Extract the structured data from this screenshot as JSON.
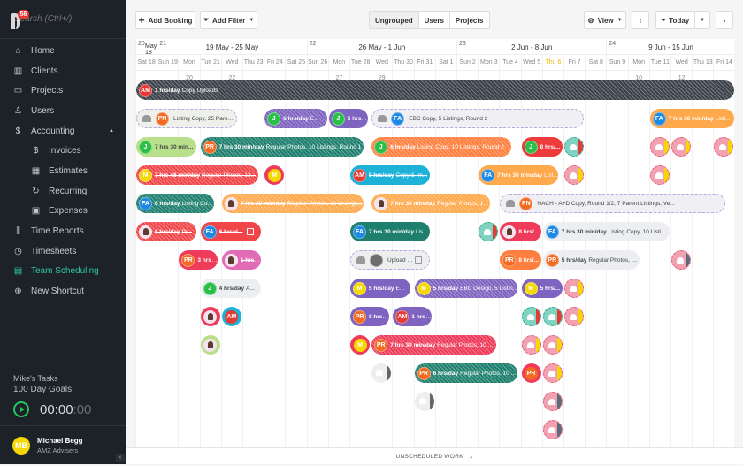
{
  "sidebar": {
    "search_placeholder": "Search (Ctrl+/)",
    "notification_count": "56",
    "items": [
      {
        "label": "Home",
        "icon": "home-icon"
      },
      {
        "label": "Clients",
        "icon": "building-icon"
      },
      {
        "label": "Projects",
        "icon": "folder-icon"
      },
      {
        "label": "Users",
        "icon": "user-icon"
      },
      {
        "label": "Accounting",
        "icon": "dollar-book-icon",
        "expanded": true
      },
      {
        "label": "Invoices",
        "icon": "invoice-icon",
        "sub": true
      },
      {
        "label": "Estimates",
        "icon": "calculator-icon",
        "sub": true
      },
      {
        "label": "Recurring",
        "icon": "refresh-icon",
        "sub": true
      },
      {
        "label": "Expenses",
        "icon": "wallet-icon",
        "sub": true
      },
      {
        "label": "Time Reports",
        "icon": "bar-chart-icon"
      },
      {
        "label": "Timesheets",
        "icon": "clock-icon"
      },
      {
        "label": "Team Scheduling",
        "icon": "calendar-icon",
        "active": true
      },
      {
        "label": "New Shortcut",
        "icon": "plus-circle-icon"
      }
    ],
    "tasks": {
      "title": "Mike's Tasks",
      "goal": "100 Day Goals",
      "timer_main": "00:00",
      "timer_sec": ":00"
    },
    "user": {
      "initials": "MB",
      "name": "Michael Begg",
      "org": "AMZ Advisers"
    }
  },
  "toolbar": {
    "add_booking": "Add Booking",
    "add_filter": "Add Filter",
    "group_tabs": [
      "Ungrouped",
      "Users",
      "Projects"
    ],
    "active_group": "Ungrouped",
    "view": "View",
    "today": "Today"
  },
  "calendar": {
    "weeks": [
      {
        "num": "20",
        "label": "May 18",
        "days": 1
      },
      {
        "num": "21",
        "label": "19 May - 25 May",
        "days": 7
      },
      {
        "num": "22",
        "label": "26 May - 1 Jun",
        "days": 7
      },
      {
        "num": "23",
        "label": "2 Jun - 8 Jun",
        "days": 7
      },
      {
        "num": "24",
        "label": "9 Jun - 15 Jun",
        "days": 6
      }
    ],
    "days": [
      "Sat 18",
      "Sun 19",
      "Mon 20",
      "Tue 21",
      "Wed 22",
      "Thu 23",
      "Fri 24",
      "Sat 25",
      "Sun 26",
      "Mon 27",
      "Tue 28",
      "Wed 29",
      "Thu 30",
      "Fri 31",
      "Sat 1",
      "Sun 2",
      "Mon 3",
      "Tue 4",
      "Wed 5",
      "Thu 6",
      "Fri 7",
      "Sat 8",
      "Sun 9",
      "Mon 10",
      "Tue 11",
      "Wed 12",
      "Thu 13",
      "Fri 14"
    ],
    "today_index": 19,
    "bars": [
      {
        "row": 0,
        "start": 0,
        "span": 28,
        "color": "#3c424a",
        "av": "AM",
        "avc": "#e53935",
        "bold": "1 hrs/day",
        "text": "Copy Uploads",
        "hatch": true
      },
      {
        "row": 1,
        "start": 0,
        "span": 4.8,
        "color": "#eef0ec",
        "dark": true,
        "ghost": true,
        "av": "PN",
        "avc": "#f26a21",
        "bold": "",
        "text": "Listing Copy, 25 Parent L..."
      },
      {
        "row": 1,
        "start": 6,
        "span": 3,
        "color": "#7e63c0",
        "av": "J",
        "avc": "#2bbf4a",
        "bold": "6 hrs/day",
        "text": "E...",
        "hatch": true
      },
      {
        "row": 1,
        "start": 9,
        "span": 1.9,
        "color": "#7e63c0",
        "av": "J",
        "avc": "#2bbf4a",
        "bold": "5 hrs/...",
        "text": ""
      },
      {
        "row": 1,
        "start": 11,
        "span": 10,
        "color": "#f0f0f4",
        "dark": true,
        "ghost": true,
        "av": "FA",
        "avc": "#1e88e5",
        "bold": "",
        "text": "EBC Copy, 5 Listings, Round 2"
      },
      {
        "row": 1,
        "start": 24,
        "span": 4,
        "color": "#ffa94d",
        "av": "FA",
        "avc": "#1e88e5",
        "bold": "7 hrs 30 min/day",
        "text": "Listi..."
      },
      {
        "row": 2,
        "start": 0,
        "span": 2.9,
        "color": "#b8e08a",
        "dark": true,
        "av": "J",
        "avc": "#2bbf4a",
        "bold": "7 hrs 30 min...",
        "text": ""
      },
      {
        "row": 2,
        "start": 3,
        "span": 7.7,
        "color": "#1f7f6e",
        "av": "PR",
        "avc": "#f26a21",
        "bold": "7 hrs 30 min/day",
        "text": "Regular Photos, 10 Listings, Round 1",
        "hatch": true
      },
      {
        "row": 2,
        "start": 11,
        "span": 6.6,
        "color": "#ff7f3f",
        "av": "J",
        "avc": "#2bbf4a",
        "bold": "6 hrs/day",
        "text": "Listing Copy, 10 Listings, Round 2",
        "hatch": true
      },
      {
        "row": 2,
        "start": 18,
        "span": 2,
        "color": "#ee3b3b",
        "av": "J",
        "avc": "#2bbf4a",
        "bold": "8 hrs/...",
        "text": ""
      },
      {
        "row": 3,
        "start": 0,
        "span": 5.8,
        "color": "#f0464a",
        "av": "M",
        "avc": "#f5d800",
        "bold": "7 hrs 48 min/day",
        "text": "Regular Photos, 13...",
        "strike": true,
        "hatch": true
      },
      {
        "row": 3,
        "start": 10,
        "span": 3.8,
        "color": "#1fb2d9",
        "av": "AM",
        "avc": "#e53935",
        "bold": "5 hrs/day",
        "text": "Copy & Im...",
        "strike": true
      },
      {
        "row": 3,
        "start": 16,
        "span": 3.8,
        "color": "#ffa94d",
        "av": "FA",
        "avc": "#1e88e5",
        "bold": "7 hrs 30 min/day",
        "text": "List..."
      },
      {
        "row": 4,
        "start": 0,
        "span": 3.7,
        "color": "#1f7f6e",
        "av": "FA",
        "avc": "#1e88e5",
        "bold": "6 hrs/day",
        "text": "Listing Co...",
        "hatch": true
      },
      {
        "row": 4,
        "start": 4,
        "span": 6.7,
        "color": "#ffa94d",
        "av": "person",
        "avc": "#f3e3ef",
        "bold": "7 hrs 30 min/day",
        "text": "Regular Photos, 10 Listings...",
        "strike": true,
        "hatch": true
      },
      {
        "row": 4,
        "start": 11,
        "span": 5.6,
        "color": "#ffa94d",
        "av": "person",
        "avc": "#f3e3ef",
        "bold": "7 hrs 30 min/day",
        "text": "Regular Photos, 10 ...",
        "hatch": true
      },
      {
        "row": 4,
        "start": 17,
        "span": 10.6,
        "color": "#f0f0f4",
        "dark": true,
        "ghost": true,
        "av": "PN",
        "avc": "#f26a21",
        "bold": "",
        "text": "NACH - A+D Copy, Round 1/2, 7 Parent Listings, Ve..."
      },
      {
        "row": 5,
        "start": 0,
        "span": 2.9,
        "color": "#f0464a",
        "av": "person",
        "avc": "#f3e3ef",
        "bold": "6 hrs/day",
        "text": "Pr...",
        "strike": true,
        "hatch": true
      },
      {
        "row": 5,
        "start": 3,
        "span": 2.9,
        "color": "#f0464a",
        "av": "FA",
        "avc": "#1e88e5",
        "bold": "6 hrs/d...",
        "text": "",
        "strike": true,
        "note": true
      },
      {
        "row": 5,
        "start": 10,
        "span": 3.8,
        "color": "#1f7f6e",
        "av": "FA",
        "avc": "#1e88e5",
        "bold": "7 hrs 30 min/day",
        "text": "Lis..."
      },
      {
        "row": 5,
        "start": 17,
        "span": 2,
        "color": "#ee3b5a",
        "av": "person",
        "avc": "#f3e3ef",
        "bold": "8 hrs/...",
        "text": ""
      },
      {
        "row": 5,
        "start": 19,
        "span": 6,
        "color": "#eceef2",
        "dark": true,
        "av": "FA",
        "avc": "#1e88e5",
        "bold": "7 hrs 30 min/day",
        "text": "Listing Copy, 10 Listi..."
      },
      {
        "row": 6,
        "start": 2,
        "span": 1.9,
        "color": "#ee3b5a",
        "av": "PR",
        "avc": "#f26a21",
        "bold": "3 hrs/...",
        "text": ""
      },
      {
        "row": 6,
        "start": 4,
        "span": 1.9,
        "color": "#e26bb6",
        "av": "person",
        "avc": "#f3e3ef",
        "bold": "1 hrs/...",
        "text": "",
        "strike": true
      },
      {
        "row": 6,
        "start": 10,
        "span": 3.8,
        "color": "#eceeef",
        "dark": true,
        "ghost": true,
        "av": "photo",
        "avc": "#777",
        "bold": "",
        "text": "Upload Tra...",
        "note": true
      },
      {
        "row": 6,
        "start": 17,
        "span": 2,
        "color": "#ff7f3f",
        "av": "PR",
        "avc": "#f26a21",
        "bold": "8 hrs/...",
        "text": ""
      },
      {
        "row": 6,
        "start": 19,
        "span": 4.6,
        "color": "#eceef2",
        "dark": true,
        "av": "PR",
        "avc": "#f26a21",
        "bold": "5 hrs/day",
        "text": "Regular Photos, 5 Li..."
      },
      {
        "row": 7,
        "start": 3,
        "span": 2.9,
        "color": "#eceef2",
        "dark": true,
        "av": "J",
        "avc": "#2bbf4a",
        "bold": "4 hrs/day",
        "text": "A..."
      },
      {
        "row": 7,
        "start": 10,
        "span": 2.9,
        "color": "#7e63c0",
        "av": "M",
        "avc": "#f5d800",
        "bold": "5 hrs/day",
        "text": "E..."
      },
      {
        "row": 7,
        "start": 13,
        "span": 4.9,
        "color": "#7e63c0",
        "av": "M",
        "avc": "#f5d800",
        "bold": "5 hrs/day",
        "text": "EBC Design, 5 Listin...",
        "hatch": true
      },
      {
        "row": 7,
        "start": 18,
        "span": 2,
        "color": "#7e63c0",
        "av": "M",
        "avc": "#f5d800",
        "bold": "5 hrs/...",
        "text": ""
      },
      {
        "row": 8,
        "start": 10,
        "span": 1.9,
        "color": "#7e63c0",
        "av": "PR",
        "avc": "#f26a21",
        "bold": "8 hrs/...",
        "text": "",
        "strike": true
      },
      {
        "row": 8,
        "start": 12,
        "span": 1.9,
        "color": "#7e63c0",
        "av": "AM",
        "avc": "#e53935",
        "bold": "1 hrs/...",
        "text": ""
      },
      {
        "row": 9,
        "start": 11,
        "span": 5.9,
        "color": "#ee3b5a",
        "av": "PR",
        "avc": "#f26a21",
        "bold": "7 hrs 30 min/day",
        "text": "Regular Photos, 10 ...",
        "hatch": true
      },
      {
        "row": 10,
        "start": 13,
        "span": 4.9,
        "color": "#1f7f6e",
        "av": "PR",
        "avc": "#f26a21",
        "bold": "6 hrs/day",
        "text": "Regular Photos, 10 ...",
        "hatch": true
      }
    ],
    "avatars": [
      {
        "row": 3,
        "start": 6,
        "kind": "M",
        "ring": "#ee3b5a",
        "fill": "#f5d800"
      },
      {
        "row": 8,
        "start": 3,
        "kind": "person",
        "ring": "#ee3b5a",
        "fill": "#f3e3ef"
      },
      {
        "row": 8,
        "start": 4,
        "kind": "AM",
        "ring": "#1fb2d9",
        "fill": "#e53935"
      },
      {
        "row": 9,
        "start": 3,
        "kind": "person",
        "ring": "#b8e08a",
        "fill": "#f3e3ef"
      },
      {
        "row": 9,
        "start": 10,
        "kind": "M",
        "ring": "#ee3b5a",
        "fill": "#f5d800"
      },
      {
        "row": 10,
        "start": 18,
        "kind": "PR",
        "ring": "#ee3b5a",
        "fill": "#f26a21"
      }
    ],
    "ghosts": [
      {
        "row": 2,
        "start": 20,
        "type": "teal",
        "half": "#e53935"
      },
      {
        "row": 2,
        "start": 24,
        "type": "pink",
        "half": "#f5d800"
      },
      {
        "row": 2,
        "start": 25,
        "type": "pink",
        "half": "#f5d800"
      },
      {
        "row": 2,
        "start": 27,
        "type": "pink",
        "half": "#f5d800"
      },
      {
        "row": 3,
        "start": 20,
        "type": "pink",
        "half": "#f5d800"
      },
      {
        "row": 3,
        "start": 24,
        "type": "pink",
        "half": "#f5d800"
      },
      {
        "row": 5,
        "start": 16,
        "type": "teal",
        "half": "#e53935"
      },
      {
        "row": 6,
        "start": 25,
        "type": "pink",
        "half": "#5b6b7e"
      },
      {
        "row": 7,
        "start": 20,
        "type": "pink",
        "half": "#f5d800"
      },
      {
        "row": 8,
        "start": 18,
        "type": "teal",
        "half": "#e53935"
      },
      {
        "row": 8,
        "start": 19,
        "type": "teal",
        "half": "#e53935"
      },
      {
        "row": 8,
        "start": 20,
        "type": "pink",
        "half": "#f5d800"
      },
      {
        "row": 9,
        "start": 18,
        "type": "pink",
        "half": "#f5d800"
      },
      {
        "row": 9,
        "start": 19,
        "type": "pink",
        "half": "#f5d800"
      },
      {
        "row": 10,
        "start": 11,
        "type": "grey",
        "half": "#666"
      },
      {
        "row": 10,
        "start": 19,
        "type": "pink",
        "half": "#f5d800"
      },
      {
        "row": 11,
        "start": 13,
        "type": "grey",
        "half": "#666"
      },
      {
        "row": 11,
        "start": 19,
        "type": "pink",
        "half": "#5b6b7e"
      },
      {
        "row": 12,
        "start": 19,
        "type": "pink",
        "half": "#5b6b7e"
      }
    ]
  },
  "footer": {
    "unscheduled": "UNSCHEDULED WORK",
    "arrow": "▲"
  }
}
